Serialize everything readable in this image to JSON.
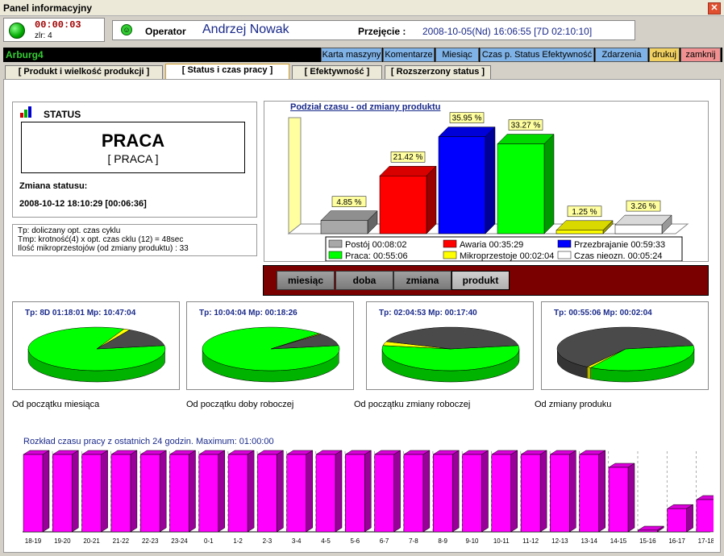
{
  "window": {
    "title": "Panel informacyjny",
    "close": "✕"
  },
  "state": {
    "timer": "00:00:03",
    "counter": "zlr: 4"
  },
  "operator": {
    "label": "Operator",
    "name": "Andrzej Nowak",
    "takeover_label": "Przejęcie :",
    "takeover_value": "2008-10-05(Nd) 16:06:55 [7D 02:10:10]"
  },
  "machine": {
    "name": "Arburg4"
  },
  "toolbar": [
    {
      "label": "Karta maszyny",
      "color": "#7fb2e6"
    },
    {
      "label": "Komentarze",
      "color": "#7fb2e6"
    },
    {
      "label": "Miesiąc",
      "color": "#7fb2e6"
    },
    {
      "label": "Czas p. Status Efektywność",
      "color": "#7fb2e6"
    },
    {
      "label": "Zdarzenia",
      "color": "#7fb2e6"
    },
    {
      "label": "drukuj",
      "color": "#f0d060"
    },
    {
      "label": "zamknij",
      "color": "#f09090"
    }
  ],
  "tabs": [
    {
      "label": "[  Produkt i wielkość produkcji  ]"
    },
    {
      "label": "[  Status i czas pracy  ]",
      "active": true
    },
    {
      "label": "[  Efektywność  ]"
    },
    {
      "label": "[ Rozszerzony status ]"
    }
  ],
  "status": {
    "title": "STATUS",
    "main": "PRACA",
    "sub": "[ PRACA ]",
    "change_label": "Zmiana statusu:",
    "change_value": "2008-10-12  18:10:29  [00:06:36]"
  },
  "info": [
    "Tp:  doliczany opt. czas cyklu",
    "Tmp: krotność(4) x opt. czas cklu (12) = 48sec",
    "Ilość  mikroprzestojów (od zmiany produktu) : 33"
  ],
  "period_buttons": [
    {
      "label": "miesiąc"
    },
    {
      "label": "doba"
    },
    {
      "label": "zmiana"
    },
    {
      "label": "produkt",
      "active": true
    }
  ],
  "chart_data": [
    {
      "type": "bar",
      "title": "Podział czasu - od zmiany produktu",
      "categories": [
        "Postój",
        "Awaria",
        "Przezbrajanie",
        "Praca",
        "Mikroprzestoje",
        "Czas nieozn."
      ],
      "values": [
        4.85,
        21.42,
        35.95,
        33.27,
        1.25,
        3.26
      ],
      "labels": [
        "4.85 %",
        "21.42 %",
        "35.95 %",
        "33.27 %",
        "1.25 %",
        "3.26 %"
      ],
      "colors": [
        "#a8a8a8",
        "#ff0000",
        "#0000ff",
        "#00ff00",
        "#ffff00",
        "#ffffff"
      ],
      "legend": [
        "Postój 00:08:02",
        "Awaria 00:35:29",
        "Przezbrajanie 00:59:33",
        "Praca: 00:55:06",
        "Mikroprzestoje 00:02:04",
        "Czas nieozn. 00:05:24"
      ],
      "ylim": [
        0,
        40
      ]
    },
    {
      "type": "pie",
      "title": "Tp: 8D 01:18:01  Mp: 10:47:04",
      "caption": "Od początku miesiąca",
      "slices": [
        {
          "value": 0.84,
          "color": "#00ff00"
        },
        {
          "value": 0.015,
          "color": "#ffff00"
        },
        {
          "value": 0.145,
          "color": "#4a4a4a"
        }
      ]
    },
    {
      "type": "pie",
      "title": "Tp: 10:04:04  Mp: 00:18:26",
      "caption": "Od początku doby roboczej",
      "slices": [
        {
          "value": 0.9,
          "color": "#00ff00"
        },
        {
          "value": 0.005,
          "color": "#ffff00"
        },
        {
          "value": 0.095,
          "color": "#4a4a4a"
        }
      ]
    },
    {
      "type": "pie",
      "title": "Tp: 02:04:53  Mp: 00:17:40",
      "caption": "Od początku zmiany roboczej",
      "slices": [
        {
          "value": 0.55,
          "color": "#00ff00"
        },
        {
          "value": 0.03,
          "color": "#ffff00"
        },
        {
          "value": 0.42,
          "color": "#4a4a4a"
        }
      ]
    },
    {
      "type": "pie",
      "title": "Tp: 00:55:06  Mp: 00:02:04",
      "caption": "Od zmiany produku",
      "slices": [
        {
          "value": 0.36,
          "color": "#00ff00"
        },
        {
          "value": 0.01,
          "color": "#ffff00"
        },
        {
          "value": 0.63,
          "color": "#4a4a4a"
        }
      ]
    },
    {
      "type": "bar",
      "title": "Rozkład czasu pracy z ostatnich 24 godzin. Maximum: 01:00:00",
      "categories": [
        "18-19",
        "19-20",
        "20-21",
        "21-22",
        "22-23",
        "23-24",
        "0-1",
        "1-2",
        "2-3",
        "3-4",
        "4-5",
        "5-6",
        "6-7",
        "7-8",
        "8-9",
        "9-10",
        "10-11",
        "11-12",
        "12-13",
        "13-14",
        "14-15",
        "15-16",
        "16-17",
        "17-18"
      ],
      "values": [
        60,
        60,
        60,
        60,
        60,
        60,
        60,
        60,
        60,
        60,
        60,
        60,
        60,
        60,
        60,
        60,
        60,
        60,
        60,
        60,
        50,
        0,
        18,
        25
      ],
      "ylim": [
        0,
        60
      ],
      "color": "#ff00ff"
    }
  ]
}
